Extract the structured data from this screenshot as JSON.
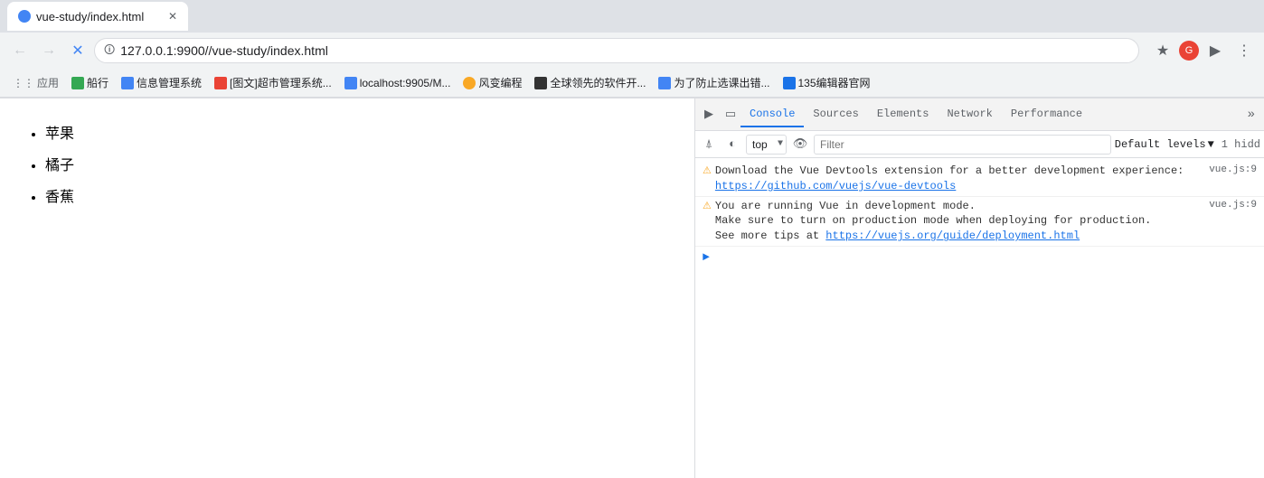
{
  "browser": {
    "tab_title": "vue-study/index.html",
    "url": "127.0.0.1:9900//vue-study/index.html",
    "url_full": "127.0.0.1:9900//vue-study/index.html"
  },
  "bookmarks": [
    {
      "label": "应用",
      "icon_color": "#4285f4"
    },
    {
      "label": "船行",
      "icon_color": "#34a853"
    },
    {
      "label": "信息管理系统",
      "icon_color": "#4285f4"
    },
    {
      "label": "[图文]超市管理系统...",
      "icon_color": "#ea4335"
    },
    {
      "label": "localhost:9905/M...",
      "icon_color": "#4285f4"
    },
    {
      "label": "风变编程",
      "icon_color": "#333"
    },
    {
      "label": "全球领先的软件开...",
      "icon_color": "#333"
    },
    {
      "label": "为了防止选课出错...",
      "icon_color": "#4285f4"
    },
    {
      "label": "135编辑器官网",
      "icon_color": "#4285f4"
    }
  ],
  "page": {
    "fruits": [
      "苹果",
      "橘子",
      "香蕉"
    ]
  },
  "devtools": {
    "tabs": [
      "Console",
      "Sources",
      "Elements",
      "Network",
      "Performance"
    ],
    "active_tab": "Console",
    "toolbar": {
      "context": "top",
      "filter_placeholder": "Filter",
      "levels_label": "Default levels",
      "hidden_count": "1 hidd"
    },
    "messages": [
      {
        "type": "warning",
        "lines": [
          "Download the Vue Devtools extension for a better development",
          "experience:",
          "https://github.com/vuejs/vue-devtools"
        ],
        "link": "https://github.com/vuejs/vue-devtools",
        "source": "vue.js:9"
      },
      {
        "type": "warning",
        "lines": [
          "You are running Vue in development mode.",
          "Make sure to turn on production mode when deploying for production.",
          "See more tips at https://vuejs.org/guide/deployment.html"
        ],
        "link": "https://vuejs.org/guide/deployment.html",
        "source": "vue.js:9"
      }
    ]
  }
}
